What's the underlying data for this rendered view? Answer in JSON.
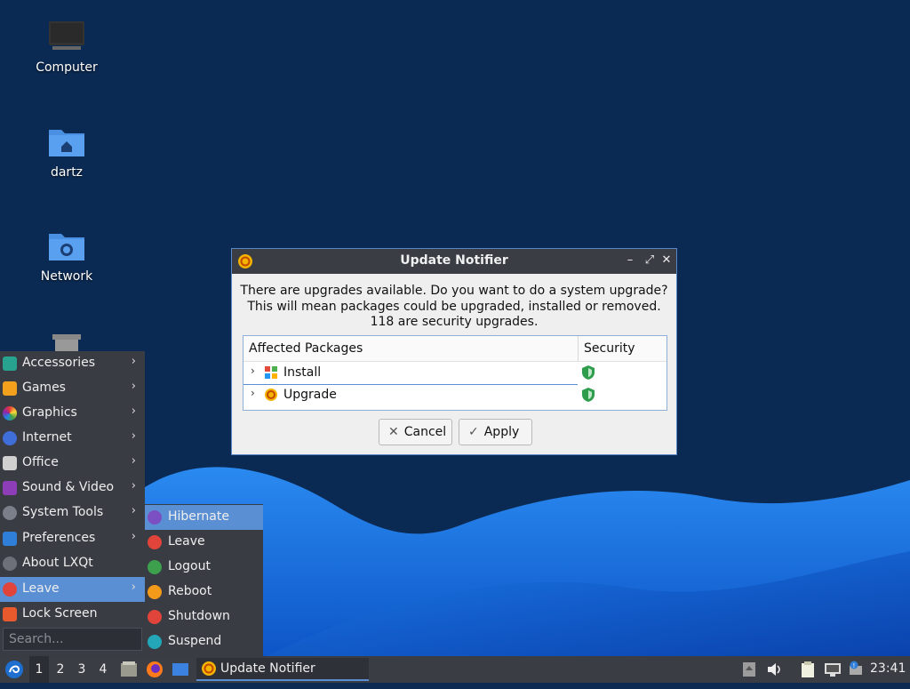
{
  "desktop": {
    "icons": [
      {
        "label": "Computer",
        "icon": "computer-icon"
      },
      {
        "label": "dartz",
        "icon": "home-folder-icon"
      },
      {
        "label": "Network",
        "icon": "network-folder-icon"
      },
      {
        "label": "",
        "icon": "trash-icon"
      }
    ]
  },
  "dialog": {
    "title": "Update Notifier",
    "message": [
      "There are upgrades available. Do you want to do a system upgrade?",
      "This will mean packages could be upgraded, installed or removed.",
      "118 are security upgrades."
    ],
    "columns": [
      "Affected Packages",
      "Security"
    ],
    "rows": [
      {
        "name": "Install",
        "icon": "install-package-icon",
        "security_icon": "shield-icon"
      },
      {
        "name": "Upgrade",
        "icon": "upgrade-package-icon",
        "security_icon": "shield-icon"
      }
    ],
    "buttons": {
      "cancel": "Cancel",
      "apply": "Apply"
    }
  },
  "start_menu": {
    "items": [
      {
        "label": "Accessories",
        "icon": "accessories-icon",
        "has_submenu": true
      },
      {
        "label": "Games",
        "icon": "games-icon",
        "has_submenu": true
      },
      {
        "label": "Graphics",
        "icon": "graphics-icon",
        "has_submenu": true
      },
      {
        "label": "Internet",
        "icon": "internet-icon",
        "has_submenu": true
      },
      {
        "label": "Office",
        "icon": "office-icon",
        "has_submenu": true
      },
      {
        "label": "Sound & Video",
        "icon": "sound-video-icon",
        "has_submenu": true
      },
      {
        "label": "System Tools",
        "icon": "system-tools-icon",
        "has_submenu": true
      },
      {
        "label": "Preferences",
        "icon": "preferences-icon",
        "has_submenu": true
      },
      {
        "label": "About LXQt",
        "icon": "info-icon",
        "has_submenu": false
      },
      {
        "label": "Leave",
        "icon": "power-icon",
        "has_submenu": true,
        "active": true
      },
      {
        "label": "Lock Screen",
        "icon": "lock-icon",
        "has_submenu": false
      }
    ],
    "search_placeholder": "Search..."
  },
  "leave_submenu": {
    "items": [
      {
        "label": "Hibernate",
        "icon": "hibernate-icon",
        "active": true
      },
      {
        "label": "Leave",
        "icon": "power-icon"
      },
      {
        "label": "Logout",
        "icon": "logout-icon"
      },
      {
        "label": "Reboot",
        "icon": "reboot-icon"
      },
      {
        "label": "Shutdown",
        "icon": "shutdown-icon"
      },
      {
        "label": "Suspend",
        "icon": "suspend-icon"
      }
    ]
  },
  "taskbar": {
    "workspaces": [
      "1",
      "2",
      "3",
      "4"
    ],
    "active_workspace": "1",
    "task_label": "Update Notifier",
    "clock": "23:41"
  },
  "colors": {
    "accent": "#5b8fd3",
    "panel": "#3b3d45",
    "desktop_dark": "#0d2b55",
    "wave": "#1565d8"
  }
}
